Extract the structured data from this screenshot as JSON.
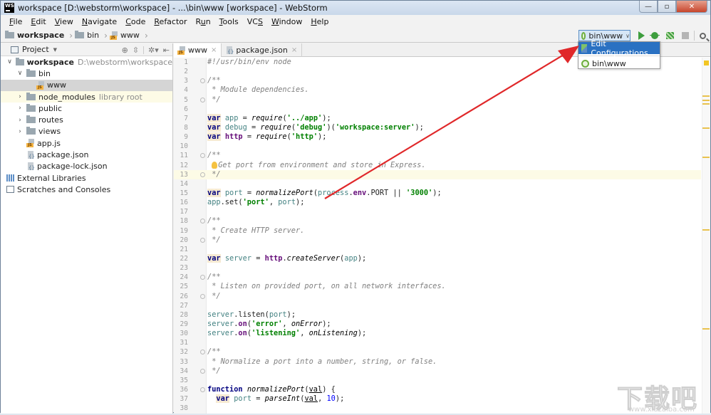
{
  "window": {
    "title": "workspace [D:\\webstorm\\workspace] - ...\\bin\\www [workspace] - WebStorm",
    "app_icon": "WS",
    "controls": {
      "minimize": "—",
      "maximize": "▫",
      "close": "✕"
    }
  },
  "menubar": {
    "items": [
      {
        "label": "File",
        "mnemonic": "F",
        "rest": "ile"
      },
      {
        "label": "Edit",
        "mnemonic": "E",
        "rest": "dit"
      },
      {
        "label": "View",
        "mnemonic": "V",
        "rest": "iew"
      },
      {
        "label": "Navigate",
        "mnemonic": "N",
        "rest": "avigate"
      },
      {
        "label": "Code",
        "mnemonic": "C",
        "rest": "ode"
      },
      {
        "label": "Refactor",
        "mnemonic": "R",
        "rest": "efactor"
      },
      {
        "label": "Run",
        "pre": "R",
        "mnemonic": "u",
        "rest": "n"
      },
      {
        "label": "Tools",
        "mnemonic": "T",
        "rest": "ools"
      },
      {
        "label": "VCS",
        "pre": "VC",
        "mnemonic": "S",
        "rest": ""
      },
      {
        "label": "Window",
        "mnemonic": "W",
        "rest": "indow"
      },
      {
        "label": "Help",
        "mnemonic": "H",
        "rest": "elp"
      }
    ]
  },
  "breadcrumb": {
    "items": [
      "workspace",
      "bin",
      "www"
    ]
  },
  "toolbar": {
    "run_config": "bin\\www",
    "chevron": "∨"
  },
  "run_dropdown": {
    "items": [
      "Edit Configurations...",
      "bin\\www"
    ]
  },
  "project": {
    "title": "Project",
    "tree": [
      {
        "label": "workspace",
        "extra": "D:\\webstorm\\workspace",
        "type": "folder",
        "depth": 0,
        "expanded": true,
        "bold": true
      },
      {
        "label": "bin",
        "type": "folder",
        "depth": 1,
        "expanded": true
      },
      {
        "label": "www",
        "type": "js",
        "depth": 2,
        "selected": true
      },
      {
        "label": "node_modules",
        "extra": "library root",
        "type": "folder",
        "depth": 1,
        "expanded": false,
        "highlight": true
      },
      {
        "label": "public",
        "type": "folder",
        "depth": 1,
        "expanded": false
      },
      {
        "label": "routes",
        "type": "folder",
        "depth": 1,
        "expanded": false
      },
      {
        "label": "views",
        "type": "folder",
        "depth": 1,
        "expanded": false
      },
      {
        "label": "app.js",
        "type": "js",
        "depth": 1
      },
      {
        "label": "package.json",
        "type": "json",
        "depth": 1
      },
      {
        "label": "package-lock.json",
        "type": "json",
        "depth": 1
      },
      {
        "label": "External Libraries",
        "type": "extlib",
        "depth": 0
      },
      {
        "label": "Scratches and Consoles",
        "type": "scratch",
        "depth": 0
      }
    ]
  },
  "editor": {
    "tabs": [
      {
        "label": "www",
        "type": "js",
        "active": true
      },
      {
        "label": "package.json",
        "type": "json",
        "active": false
      }
    ],
    "current_line": 13,
    "lines": [
      {
        "n": 1,
        "t": [
          [
            "cm",
            "#!/usr/bin/env node"
          ]
        ]
      },
      {
        "n": 2,
        "t": []
      },
      {
        "n": 3,
        "fold": true,
        "t": [
          [
            "cm",
            "/**"
          ]
        ]
      },
      {
        "n": 4,
        "t": [
          [
            "cm",
            " * Module dependencies."
          ]
        ]
      },
      {
        "n": 5,
        "fold": true,
        "t": [
          [
            "cm",
            " */"
          ]
        ]
      },
      {
        "n": 6,
        "t": []
      },
      {
        "n": 7,
        "t": [
          [
            "kw",
            "var"
          ],
          [
            "",
            " "
          ],
          [
            "var",
            "app"
          ],
          [
            "",
            " = "
          ],
          [
            "fn",
            "require"
          ],
          [
            "",
            "("
          ],
          [
            "str",
            "'../app'"
          ],
          [
            "",
            ");"
          ]
        ]
      },
      {
        "n": 8,
        "t": [
          [
            "kw",
            "var"
          ],
          [
            "",
            " "
          ],
          [
            "var",
            "debug"
          ],
          [
            "",
            " = "
          ],
          [
            "fn",
            "require"
          ],
          [
            "",
            "("
          ],
          [
            "str",
            "'debug'"
          ],
          [
            "",
            ")("
          ],
          [
            "str",
            "'workspace:server'"
          ],
          [
            "",
            ");"
          ]
        ]
      },
      {
        "n": 9,
        "t": [
          [
            "kw",
            "var"
          ],
          [
            "",
            " "
          ],
          [
            "prop",
            "http"
          ],
          [
            "",
            " = "
          ],
          [
            "fn",
            "require"
          ],
          [
            "",
            "("
          ],
          [
            "str",
            "'http'"
          ],
          [
            "",
            ");"
          ]
        ]
      },
      {
        "n": 10,
        "t": []
      },
      {
        "n": 11,
        "fold": true,
        "t": [
          [
            "cm",
            "/**"
          ]
        ]
      },
      {
        "n": 12,
        "bulb": true,
        "t": [
          [
            "cm",
            "Get port from environment and store in Express."
          ]
        ]
      },
      {
        "n": 13,
        "fold": true,
        "t": [
          [
            "cm",
            " */"
          ]
        ]
      },
      {
        "n": 14,
        "t": []
      },
      {
        "n": 15,
        "t": [
          [
            "kw",
            "var"
          ],
          [
            "",
            " "
          ],
          [
            "var",
            "port"
          ],
          [
            "",
            " = "
          ],
          [
            "fn",
            "normalizePort"
          ],
          [
            "",
            "("
          ],
          [
            "var",
            "process"
          ],
          [
            "",
            "."
          ],
          [
            "prop",
            "env"
          ],
          [
            "",
            ".PORT || "
          ],
          [
            "str",
            "'3000'"
          ],
          [
            "",
            ");"
          ]
        ]
      },
      {
        "n": 16,
        "t": [
          [
            "var",
            "app"
          ],
          [
            "",
            ".set("
          ],
          [
            "str",
            "'port'"
          ],
          [
            "",
            ", "
          ],
          [
            "var",
            "port"
          ],
          [
            "",
            ");"
          ]
        ]
      },
      {
        "n": 17,
        "t": []
      },
      {
        "n": 18,
        "fold": true,
        "t": [
          [
            "cm",
            "/**"
          ]
        ]
      },
      {
        "n": 19,
        "t": [
          [
            "cm",
            " * Create HTTP server."
          ]
        ]
      },
      {
        "n": 20,
        "fold": true,
        "t": [
          [
            "cm",
            " */"
          ]
        ]
      },
      {
        "n": 21,
        "t": []
      },
      {
        "n": 22,
        "t": [
          [
            "kw",
            "var"
          ],
          [
            "",
            " "
          ],
          [
            "var",
            "server"
          ],
          [
            "",
            " = "
          ],
          [
            "prop",
            "http"
          ],
          [
            "",
            "."
          ],
          [
            "fn",
            "createServer"
          ],
          [
            "",
            "("
          ],
          [
            "var",
            "app"
          ],
          [
            "",
            ");"
          ]
        ]
      },
      {
        "n": 23,
        "t": []
      },
      {
        "n": 24,
        "fold": true,
        "t": [
          [
            "cm",
            "/**"
          ]
        ]
      },
      {
        "n": 25,
        "t": [
          [
            "cm",
            " * Listen on provided port, on all network interfaces."
          ]
        ]
      },
      {
        "n": 26,
        "fold": true,
        "t": [
          [
            "cm",
            " */"
          ]
        ]
      },
      {
        "n": 27,
        "t": []
      },
      {
        "n": 28,
        "t": [
          [
            "var",
            "server"
          ],
          [
            "",
            ".listen("
          ],
          [
            "var",
            "port"
          ],
          [
            "",
            ");"
          ]
        ]
      },
      {
        "n": 29,
        "t": [
          [
            "var",
            "server"
          ],
          [
            "",
            "."
          ],
          [
            "prop",
            "on"
          ],
          [
            "",
            "("
          ],
          [
            "str",
            "'error'"
          ],
          [
            "",
            ", "
          ],
          [
            "fn",
            "onError"
          ],
          [
            "",
            ");"
          ]
        ]
      },
      {
        "n": 30,
        "t": [
          [
            "var",
            "server"
          ],
          [
            "",
            "."
          ],
          [
            "prop",
            "on"
          ],
          [
            "",
            "("
          ],
          [
            "str",
            "'listening'"
          ],
          [
            "",
            ", "
          ],
          [
            "fn",
            "onListening"
          ],
          [
            "",
            ");"
          ]
        ]
      },
      {
        "n": 31,
        "t": []
      },
      {
        "n": 32,
        "fold": true,
        "t": [
          [
            "cm",
            "/**"
          ]
        ]
      },
      {
        "n": 33,
        "t": [
          [
            "cm",
            " * Normalize a port into a number, string, or false."
          ]
        ]
      },
      {
        "n": 34,
        "fold": true,
        "t": [
          [
            "cm",
            " */"
          ]
        ]
      },
      {
        "n": 35,
        "t": []
      },
      {
        "n": 36,
        "fold": true,
        "t": [
          [
            "kw2",
            "function"
          ],
          [
            "",
            " "
          ],
          [
            "fn",
            "normalizePort"
          ],
          [
            "",
            "("
          ],
          [
            "ul",
            "val"
          ],
          [
            "",
            ") {"
          ]
        ]
      },
      {
        "n": 37,
        "t": [
          [
            "",
            "  "
          ],
          [
            "kw",
            "var"
          ],
          [
            "",
            " "
          ],
          [
            "var",
            "port"
          ],
          [
            "",
            " = "
          ],
          [
            "fn",
            "parseInt"
          ],
          [
            "",
            "("
          ],
          [
            "ul",
            "val"
          ],
          [
            "",
            ", "
          ],
          [
            "num",
            "10"
          ],
          [
            "",
            ");"
          ]
        ]
      },
      {
        "n": 38,
        "t": []
      }
    ]
  },
  "watermark": {
    "main": "下载吧",
    "sub": "www.xiazaiba.com"
  },
  "colors": {
    "accent": "#2a71c2",
    "annotation_arrow": "#e0282a",
    "run_green": "#3e9e3e"
  }
}
